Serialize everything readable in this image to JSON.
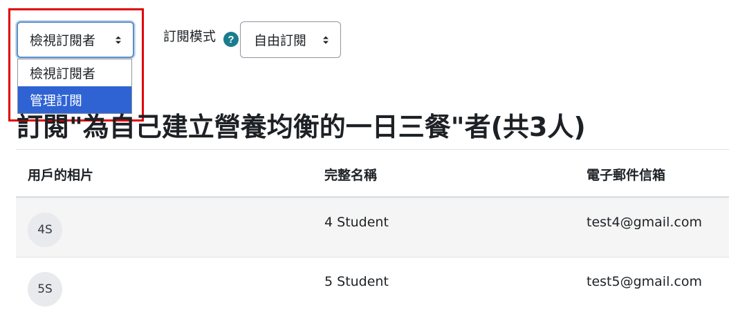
{
  "view_select": {
    "selected": "檢視訂閱者",
    "options": [
      "檢視訂閱者",
      "管理訂閱"
    ],
    "highlighted_option": "管理訂閱"
  },
  "mode": {
    "label": "訂閱模式",
    "help_icon": "?",
    "selected": "自由訂閱"
  },
  "title": "訂閱\"為自己建立營養均衡的一日三餐\"者(共3人)",
  "table": {
    "headers": {
      "photo": "用戶的相片",
      "name": "完整名稱",
      "email": "電子郵件信箱"
    },
    "rows": [
      {
        "avatar": "4S",
        "name": "4 Student",
        "email": "test4@gmail.com"
      },
      {
        "avatar": "5S",
        "name": "5 Student",
        "email": "test5@gmail.com"
      }
    ]
  },
  "colors": {
    "highlight": "#e00000",
    "selected_option": "#2f63d4",
    "help_icon": "#1b7c8f"
  }
}
